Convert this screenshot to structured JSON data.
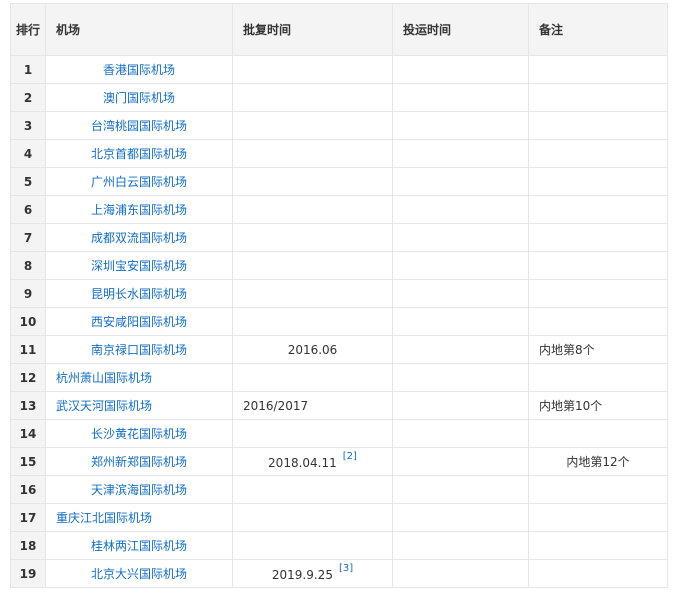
{
  "headers": {
    "rank": "排行",
    "airport": "机场",
    "approve": "批复时间",
    "open": "投运时间",
    "note": "备注"
  },
  "rows": [
    {
      "rank": "1",
      "airport": "香港国际机场",
      "approve": "",
      "ref": "",
      "open": "",
      "note": ""
    },
    {
      "rank": "2",
      "airport": "澳门国际机场",
      "approve": "",
      "ref": "",
      "open": "",
      "note": ""
    },
    {
      "rank": "3",
      "airport": "台湾桃园国际机场",
      "approve": "",
      "ref": "",
      "open": "",
      "note": ""
    },
    {
      "rank": "4",
      "airport": "北京首都国际机场",
      "approve": "",
      "ref": "",
      "open": "",
      "note": ""
    },
    {
      "rank": "5",
      "airport": "广州白云国际机场",
      "approve": "",
      "ref": "",
      "open": "",
      "note": ""
    },
    {
      "rank": "6",
      "airport": "上海浦东国际机场",
      "approve": "",
      "ref": "",
      "open": "",
      "note": ""
    },
    {
      "rank": "7",
      "airport": "成都双流国际机场",
      "approve": "",
      "ref": "",
      "open": "",
      "note": ""
    },
    {
      "rank": "8",
      "airport": "深圳宝安国际机场",
      "approve": "",
      "ref": "",
      "open": "",
      "note": ""
    },
    {
      "rank": "9",
      "airport": "昆明长水国际机场",
      "approve": "",
      "ref": "",
      "open": "",
      "note": ""
    },
    {
      "rank": "10",
      "airport": "西安咸阳国际机场",
      "approve": "",
      "ref": "",
      "open": "",
      "note": ""
    },
    {
      "rank": "11",
      "airport": "南京禄口国际机场",
      "approve": "2016.06",
      "ref": "",
      "open": "",
      "note": "内地第8个"
    },
    {
      "rank": "12",
      "airport": "杭州萧山国际机场",
      "approve": "",
      "ref": "",
      "open": "",
      "note": ""
    },
    {
      "rank": "13",
      "airport": "武汉天河国际机场",
      "approve": "2016/2017",
      "ref": "",
      "open": "",
      "note": "内地第10个"
    },
    {
      "rank": "14",
      "airport": "长沙黄花国际机场",
      "approve": "",
      "ref": "",
      "open": "",
      "note": ""
    },
    {
      "rank": "15",
      "airport": "郑州新郑国际机场",
      "approve": "2018.04.11",
      "ref": "[2]",
      "open": "",
      "note": "内地第12个"
    },
    {
      "rank": "16",
      "airport": "天津滨海国际机场",
      "approve": "",
      "ref": "",
      "open": "",
      "note": ""
    },
    {
      "rank": "17",
      "airport": "重庆江北国际机场",
      "approve": "",
      "ref": "",
      "open": "",
      "note": ""
    },
    {
      "rank": "18",
      "airport": "桂林两江国际机场",
      "approve": "",
      "ref": "",
      "open": "",
      "note": ""
    },
    {
      "rank": "19",
      "airport": "北京大兴国际机场",
      "approve": "2019.9.25",
      "ref": "[3]",
      "open": "",
      "note": ""
    }
  ]
}
